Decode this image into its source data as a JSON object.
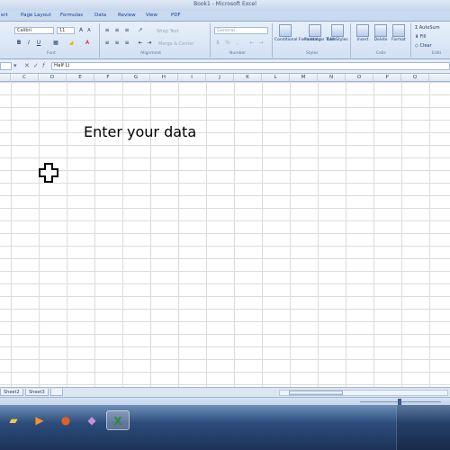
{
  "window": {
    "title": "Book1 - Microsoft Excel"
  },
  "tabs": [
    "ert",
    "Page Layout",
    "Formulas",
    "Data",
    "Review",
    "View",
    "PDF"
  ],
  "ribbon": {
    "font_name": "Calibri",
    "font_size": "11",
    "wrap_text": "Wrap Text",
    "merge_center": "Merge & Center",
    "number_format": "General",
    "conditional_formatting": "Conditional Formatting",
    "format_as_table": "Format as Table",
    "cell_styles": "Cell Styles",
    "insert": "Insert",
    "delete": "Delete",
    "format": "Format",
    "autosum": "AutoSum",
    "fill": "Fill",
    "clear": "Clear",
    "groups": {
      "font": "Font",
      "alignment": "Alignment",
      "number": "Number",
      "styles": "Styles",
      "cells": "Cells",
      "editing": "Editi"
    }
  },
  "formula_bar": {
    "value": "Half Li"
  },
  "columns": [
    "C",
    "D",
    "E",
    "F",
    "G",
    "H",
    "I",
    "J",
    "K",
    "L",
    "M",
    "N",
    "O",
    "P",
    "Q"
  ],
  "sheet": {
    "text": "Enter your data"
  },
  "sheet_tabs": [
    "Sheet2",
    "Sheet3"
  ],
  "taskbar": {
    "icons": [
      "folder-icon",
      "media-player-icon",
      "firefox-icon",
      "app-icon",
      "excel-icon"
    ]
  }
}
